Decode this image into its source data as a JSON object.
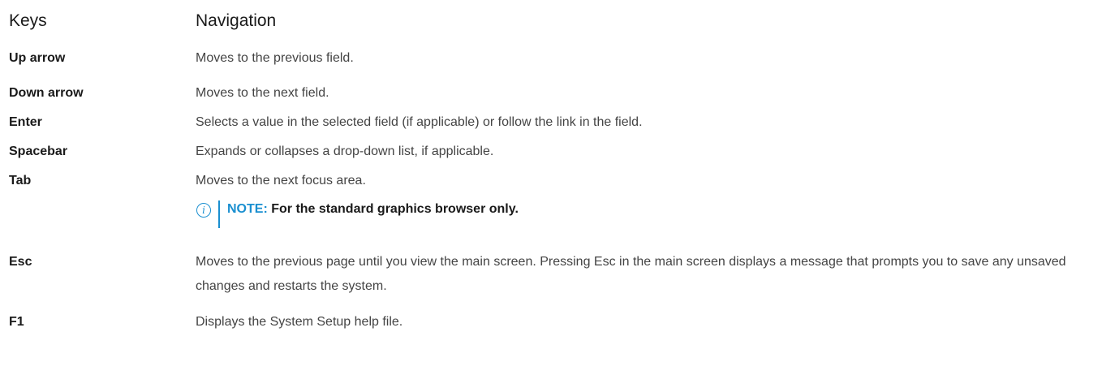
{
  "header": {
    "keys_label": "Keys",
    "navigation_label": "Navigation"
  },
  "rows": [
    {
      "key": "Up arrow",
      "description": "Moves to the previous field."
    },
    {
      "key": "Down arrow",
      "description": "Moves to the next field."
    },
    {
      "key": "Enter",
      "description": "Selects a value in the selected field (if applicable) or follow the link in the field."
    },
    {
      "key": "Spacebar",
      "description": "Expands or collapses a drop-down list, if applicable."
    },
    {
      "key": "Tab",
      "description": "Moves to the next focus area."
    },
    {
      "key": "Esc",
      "description": "Moves to the previous page until you view the main screen. Pressing Esc in the main screen displays a message that prompts you to save any unsaved changes and restarts the system."
    },
    {
      "key": "F1",
      "description": "Displays the System Setup help file."
    }
  ],
  "note": {
    "icon": "info-icon",
    "label": "NOTE:",
    "text": "For the standard graphics browser only."
  },
  "colors": {
    "accent": "#1a8fd0",
    "text": "#333333"
  }
}
